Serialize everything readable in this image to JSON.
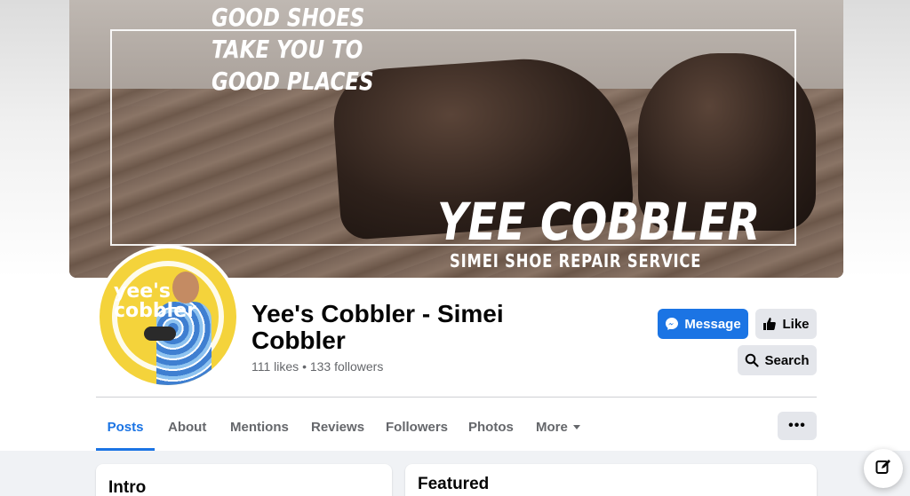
{
  "cover": {
    "slogan_line1": "GOOD SHOES",
    "slogan_line2": "TAKE YOU TO",
    "slogan_line3": "GOOD PLACES",
    "brand_title": "YEE COBBLER",
    "brand_subtitle": "SIMEI SHOE REPAIR SERVICE"
  },
  "avatar": {
    "logo_line1": "yee's",
    "logo_line2": "cobbler"
  },
  "page": {
    "name": "Yee's Cobbler - Simei Cobbler",
    "stats": "111 likes • 133 followers"
  },
  "actions": {
    "message_label": "Message",
    "like_label": "Like",
    "search_label": "Search"
  },
  "tabs": [
    {
      "label": "Posts",
      "active": true
    },
    {
      "label": "About"
    },
    {
      "label": "Mentions"
    },
    {
      "label": "Reviews"
    },
    {
      "label": "Followers"
    },
    {
      "label": "Photos"
    },
    {
      "label": "More"
    }
  ],
  "more_menu_label": "•••",
  "cards": {
    "intro_title": "Intro",
    "featured_title": "Featured"
  },
  "colors": {
    "accent": "#1b74e4",
    "secondary_button": "#e4e6eb",
    "muted_text": "#65676b"
  },
  "icons": {
    "message": "messenger-icon",
    "like": "thumbs-up-icon",
    "search": "search-icon",
    "more_tab": "caret-down-icon",
    "fab": "compose-icon"
  }
}
